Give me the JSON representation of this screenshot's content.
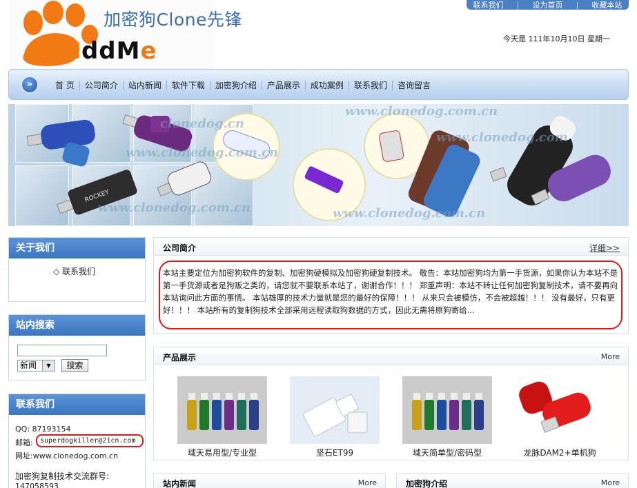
{
  "header": {
    "site_title": "加密狗Clone先锋",
    "logo_text_a": "ddM",
    "logo_text_b": "C",
    "logo_text_c": "e",
    "top_links": [
      "联系我们",
      "设为首页",
      "收藏本站"
    ],
    "date_line": "今天是  111年10月10日  星期一"
  },
  "nav": {
    "items": [
      "首 页",
      "公司简介",
      "站内新闻",
      "软件下载",
      "加密狗介绍",
      "产品展示",
      "成功案例",
      "联系我们",
      "咨询留言"
    ]
  },
  "banner": {
    "watermarks": [
      "www.clonedog.com.cn",
      "clonedog.cn",
      "www.clonedog.com",
      "www.clonedog.com.cn",
      "www.clonedog.com.cn",
      "www.clonedog.com.cn"
    ]
  },
  "sidebar": {
    "about": {
      "title": "关于我们",
      "items": [
        "◇ 联系我们"
      ]
    },
    "search": {
      "title": "站内搜索",
      "input_value": "",
      "select_value": "新闻",
      "button_label": "搜索"
    },
    "contact": {
      "title": "联系我们",
      "qq": "QQ: 87193154",
      "email_label": "邮箱:",
      "email_value": "superdogkiller@21cn.com",
      "website": "网址:www.clonedog.com.cn",
      "group_label": "加密狗复制技术交流群号:",
      "group_number": "147058593"
    }
  },
  "intro": {
    "title": "公司简介",
    "more": "详细>>",
    "text": "本站主要定位为加密狗软件的复制、加密狗硬模拟及加密狗硬复制技术。    敬告：本站加密狗均为第一手货源，如果你认为本站不是第一手货源或者是狗贩之类的，请您就不要联系本站了，谢谢合作！！！    郑重声明：本站不转让任何加密狗复制技术，请不要再向本站询问此方面的事情。    本站雄厚的技术力量就是您的最好的保障！！！    从来只会被模仿，不会被超越！！！    没有最好，只有更好！！！  本站所有的复制狗技术全部采用远程读取狗数据的方式，因此无需将原狗寄给..."
  },
  "products": {
    "title": "产品展示",
    "more": "More",
    "items": [
      {
        "label": "域天易用型/专业型"
      },
      {
        "label": "坚石ET99"
      },
      {
        "label": "域天简单型/密码型"
      },
      {
        "label": "龙脉DAM2+单机狗"
      }
    ]
  },
  "news": {
    "title": "站内新闻",
    "more": "More"
  },
  "dongle_intro": {
    "title": "加密狗介绍",
    "more": "More"
  },
  "colors": {
    "nav_blue": "#3c76c1",
    "highlight_red": "#e01818",
    "logo_orange": "#f27a15",
    "title_blue": "#3a6fb0"
  }
}
